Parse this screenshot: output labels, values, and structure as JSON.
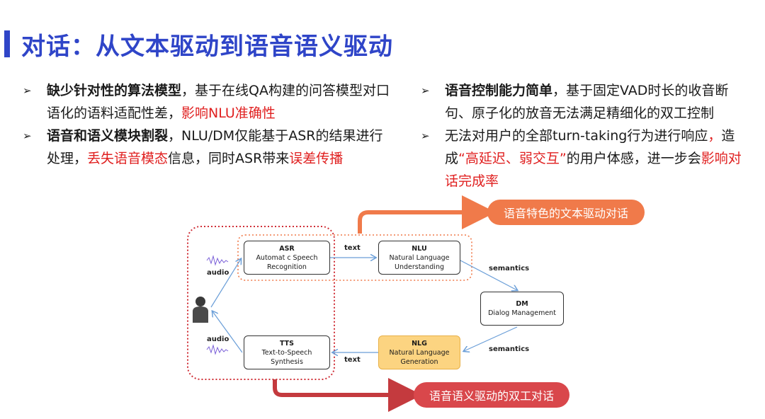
{
  "title": "对话：从文本驱动到语音语义驱动",
  "left_bullets": [
    {
      "bold": "缺少针对性的算法模型",
      "text": "，基于在线QA构建的问答模型对口语化的语料适配性差，",
      "red": "影响NLU准确性",
      "text2": ""
    },
    {
      "bold": "语音和语义模块割裂",
      "text": "，NLU/DM仅能基于ASR的结果进行处理，",
      "red": "丢失语音模态",
      "text2": "信息，同时ASR带来",
      "red2": "误差传播"
    }
  ],
  "right_bullets": [
    {
      "bold": "语音控制能力简单",
      "text": "，基于固定VAD时长的收音断句、原子化的放音无法满足精细化的双工控制"
    },
    {
      "bold": "",
      "text": "无法对用户的全部turn-taking行为进行响应",
      "red": "，",
      "text2": "造成",
      "red2": "“高延迟、弱交互”",
      "text3": "的用户体感，进一步会",
      "red3": "影响对话完成率"
    }
  ],
  "diagram": {
    "asr": {
      "abbr": "ASR",
      "line1": "Automat c Speech",
      "line2": "Recognition"
    },
    "nlu": {
      "abbr": "NLU",
      "line1": "Natural Language",
      "line2": "Understanding"
    },
    "dm": {
      "abbr": "DM",
      "line1": "Dialog Management"
    },
    "nlg": {
      "abbr": "NLG",
      "line1": "Natural Language",
      "line2": "Generation"
    },
    "tts": {
      "abbr": "TTS",
      "line1": "Text-to-Speech",
      "line2": "Synthesis"
    },
    "labels": {
      "text_top": "text",
      "text_bottom": "text",
      "semantics_top": "semantics",
      "semantics_bottom": "semantics",
      "audio_top": "audio",
      "audio_bottom": "audio"
    },
    "pill_top": "语音特色的文本驱动对话",
    "pill_bottom": "语音语义驱动的双工对话"
  },
  "colors": {
    "title": "#2f45c8",
    "red": "#e02020",
    "orange": "#f07a4a",
    "darkred": "#d9474b",
    "nlg_fill": "#fcd481"
  }
}
